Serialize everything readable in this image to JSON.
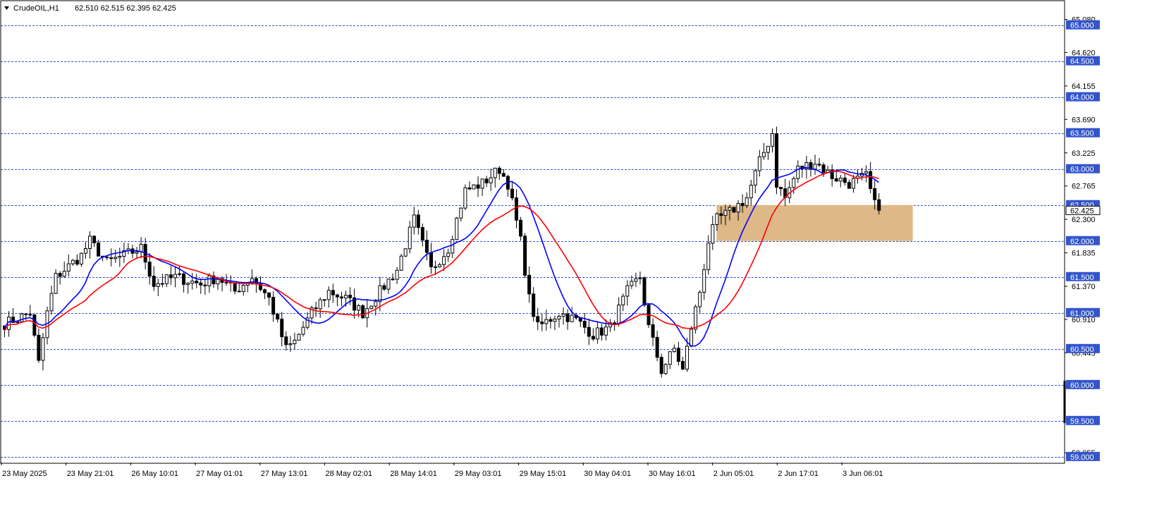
{
  "header": {
    "symbol": "CrudeOIL,H1",
    "ohlc": "62.510 62.515 62.395 62.425"
  },
  "chart_data": {
    "type": "candlestick",
    "ylim": [
      58.92,
      65.33
    ],
    "price_ticks": [
      "65.080",
      "64.620",
      "64.155",
      "63.690",
      "63.225",
      "62.765",
      "62.300",
      "61.835",
      "61.370",
      "60.910",
      "60.445",
      "59.980",
      "59.055"
    ],
    "levels": [
      "65.000",
      "64.500",
      "64.000",
      "63.500",
      "63.000",
      "62.500",
      "62.000",
      "61.500",
      "61.000",
      "60.500",
      "60.000",
      "59.500",
      "59.000"
    ],
    "current_price": "62.425",
    "time_labels": [
      "23 May 2025",
      "23 May 21:01",
      "26 May 10:01",
      "27 May 01:01",
      "27 May 13:01",
      "28 May 02:01",
      "28 May 14:01",
      "29 May 03:01",
      "29 May 15:01",
      "30 May 04:01",
      "30 May 16:01",
      "2 Jun 05:01",
      "2 Jun 17:01",
      "3 Jun 06:01"
    ],
    "zone": {
      "from_bar": 167,
      "to_bar": 213,
      "low": 62.0,
      "high": 62.5,
      "color": "#DEB887"
    },
    "colors": {
      "ma_fast": "#0000FF",
      "ma_slow": "#FF0000",
      "level": "#3355CC",
      "bull": "#FFFFFF",
      "bear": "#000000"
    },
    "keypoints": [
      [
        0,
        60.85
      ],
      [
        6,
        61.0
      ],
      [
        8,
        60.3
      ],
      [
        10,
        61.0
      ],
      [
        12,
        61.5
      ],
      [
        18,
        61.8
      ],
      [
        20,
        62.0
      ],
      [
        24,
        61.7
      ],
      [
        28,
        61.8
      ],
      [
        32,
        61.9
      ],
      [
        35,
        61.4
      ],
      [
        40,
        61.5
      ],
      [
        46,
        61.4
      ],
      [
        50,
        61.5
      ],
      [
        54,
        61.3
      ],
      [
        58,
        61.5
      ],
      [
        62,
        61.2
      ],
      [
        66,
        60.5
      ],
      [
        68,
        60.6
      ],
      [
        72,
        61.0
      ],
      [
        76,
        61.3
      ],
      [
        80,
        61.2
      ],
      [
        84,
        61.0
      ],
      [
        88,
        61.3
      ],
      [
        92,
        61.6
      ],
      [
        96,
        62.3
      ],
      [
        100,
        61.6
      ],
      [
        104,
        61.9
      ],
      [
        108,
        62.7
      ],
      [
        112,
        62.8
      ],
      [
        116,
        63.0
      ],
      [
        118,
        62.8
      ],
      [
        121,
        62.0
      ],
      [
        123,
        61.2
      ],
      [
        125,
        60.8
      ],
      [
        130,
        61.0
      ],
      [
        134,
        60.9
      ],
      [
        138,
        60.7
      ],
      [
        142,
        60.8
      ],
      [
        146,
        61.3
      ],
      [
        149,
        61.5
      ],
      [
        151,
        60.8
      ],
      [
        154,
        60.2
      ],
      [
        157,
        60.5
      ],
      [
        159,
        60.2
      ],
      [
        161,
        60.8
      ],
      [
        163,
        61.3
      ],
      [
        165,
        62.0
      ],
      [
        167,
        62.3
      ],
      [
        170,
        62.4
      ],
      [
        174,
        62.6
      ],
      [
        177,
        63.1
      ],
      [
        180,
        63.5
      ],
      [
        181,
        62.8
      ],
      [
        183,
        62.6
      ],
      [
        186,
        63.0
      ],
      [
        190,
        63.1
      ],
      [
        194,
        62.9
      ],
      [
        198,
        62.8
      ],
      [
        202,
        62.9
      ],
      [
        204,
        62.5
      ],
      [
        205,
        62.425
      ]
    ]
  }
}
